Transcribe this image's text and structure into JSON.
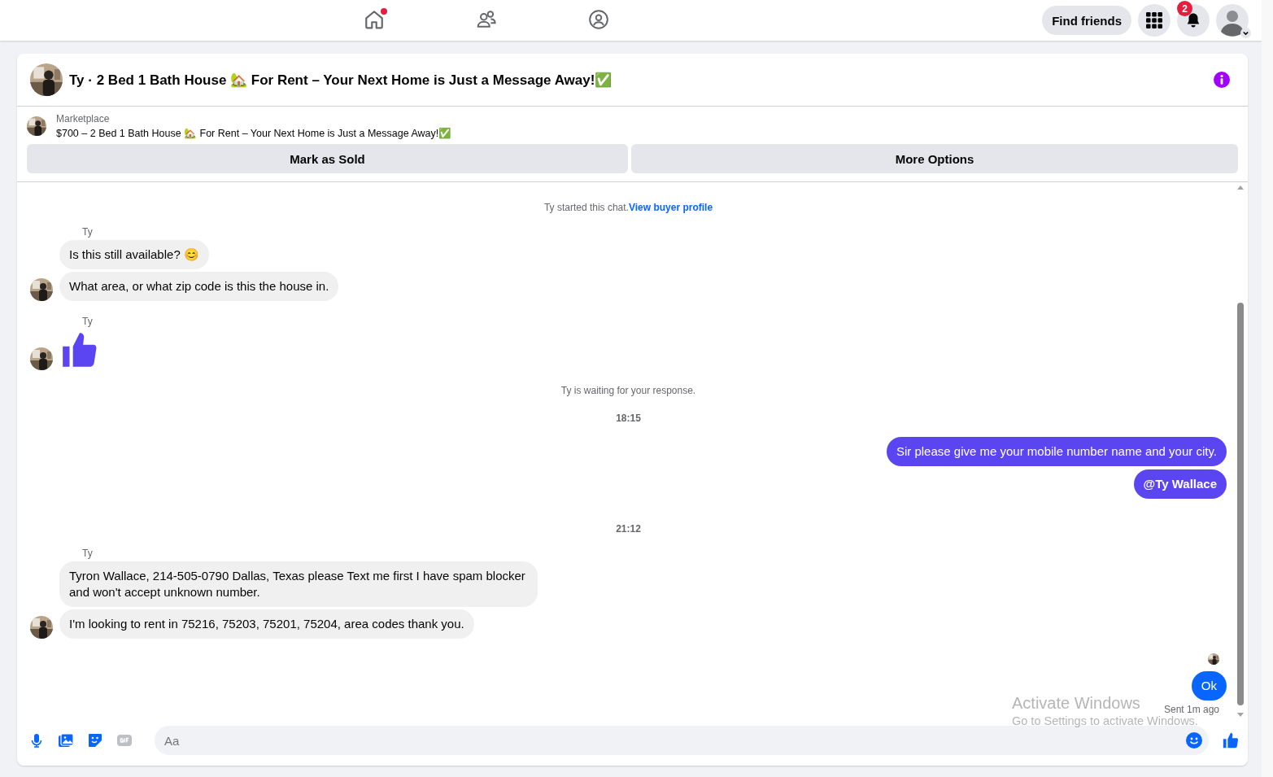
{
  "nav": {
    "tabs": [
      {
        "kind": "home",
        "selected": false,
        "dot": true
      },
      {
        "kind": "friends",
        "selected": false,
        "dot": false
      },
      {
        "kind": "groups",
        "selected": false,
        "dot": false
      }
    ],
    "find_friends": "Find friends",
    "notifications_badge": "2"
  },
  "header": {
    "title": "Ty · 2 Bed 1 Bath House 🏡 For Rent – Your Next Home is Just a Message Away!✅"
  },
  "listing": {
    "source": "Marketplace",
    "title": "$700 – 2 Bed 1 Bath House 🏡 For Rent – Your Next Home is Just a Message Away!✅",
    "buttons": [
      "Mark as Sold",
      "More Options"
    ]
  },
  "messages": [
    {
      "kind": "system",
      "text": "Ty started this chat.",
      "link": "View buyer profile"
    },
    {
      "kind": "incoming",
      "sender": "Ty",
      "bubbles": [
        {
          "kind": "text",
          "text": "Is this still available? 😊"
        },
        {
          "kind": "text",
          "text": "What area, or what zip code is this the house in."
        }
      ]
    },
    {
      "kind": "incoming",
      "sender": "Ty",
      "bubbles": [
        {
          "kind": "like"
        }
      ]
    },
    {
      "kind": "system",
      "text": "Ty is waiting for your response."
    },
    {
      "kind": "time",
      "text": "18:15"
    },
    {
      "kind": "outgoing",
      "color": "#5b45f2",
      "bubbles": [
        {
          "kind": "text",
          "text": "Sir please give me your mobile number name and your city."
        },
        {
          "kind": "mention",
          "text": "@Ty Wallace"
        }
      ]
    },
    {
      "kind": "time",
      "text": "21:12"
    },
    {
      "kind": "incoming",
      "sender": "Ty",
      "bubbles": [
        {
          "kind": "text",
          "text": "Tyron Wallace, 214-505-0790 Dallas, Texas please Text me first I have spam blocker and won't accept unknown number."
        },
        {
          "kind": "text",
          "text": "I'm looking to rent in 75216, 75203, 75201, 75204, area codes thank you."
        }
      ]
    },
    {
      "kind": "receipt"
    },
    {
      "kind": "outgoing",
      "color": "#0866ff",
      "bubbles": [
        {
          "kind": "text",
          "text": "Ok"
        }
      ],
      "status": "Sent 1m ago"
    }
  ],
  "composer": {
    "placeholder": "Aa"
  },
  "os_overlay": {
    "title": "Activate Windows",
    "hint": "Go to Settings to activate Windows."
  }
}
